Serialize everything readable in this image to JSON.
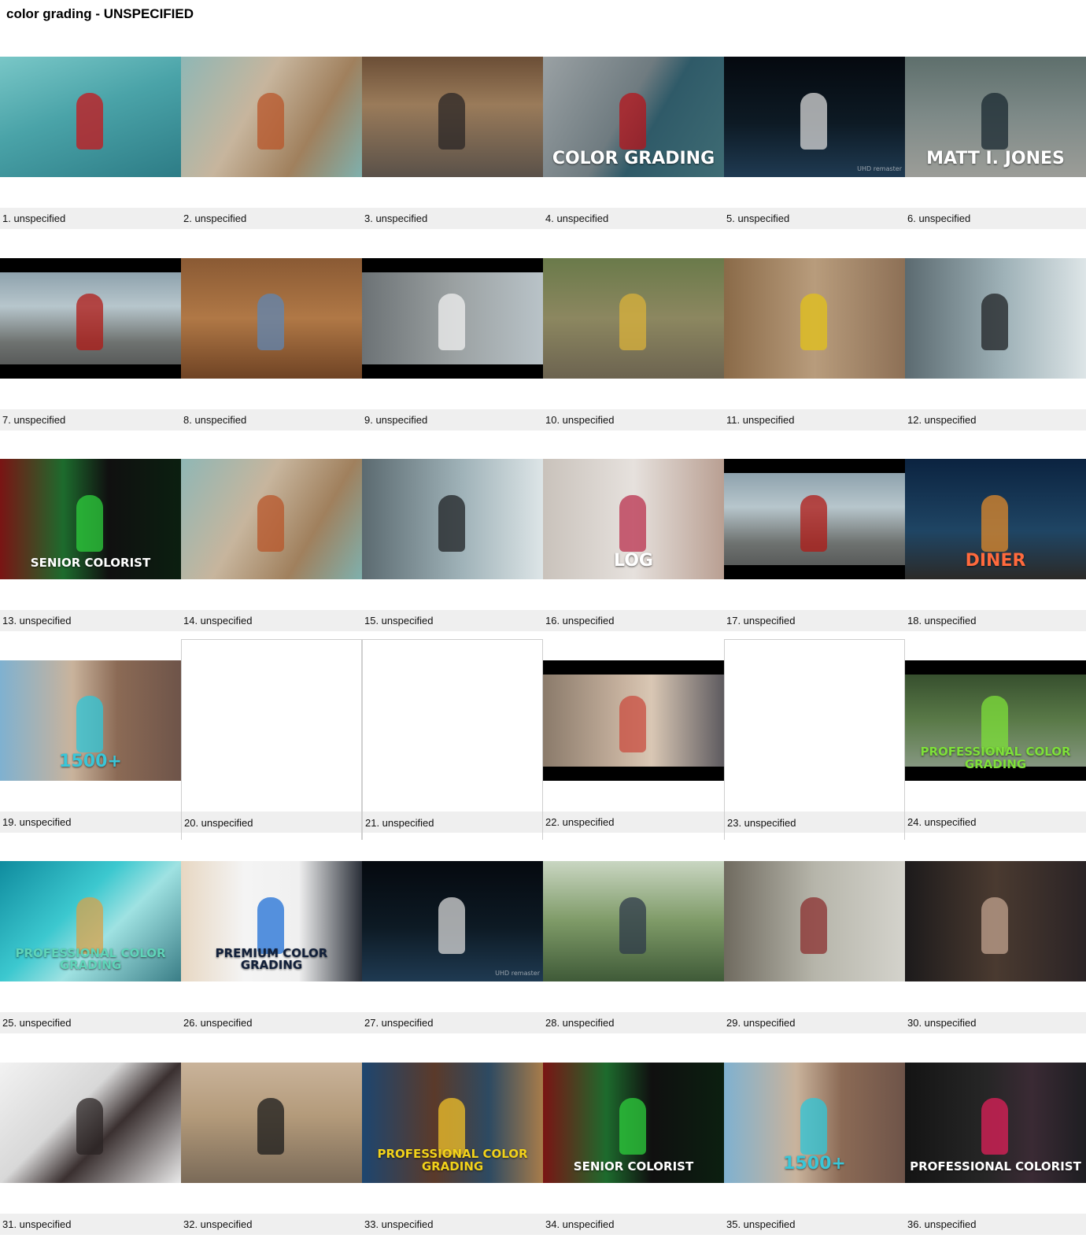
{
  "page": {
    "title": "color grading - UNSPECIFIED"
  },
  "grid": {
    "columns": 6,
    "items": [
      {
        "caption": "1. unspecified",
        "bg": "linear-gradient(160deg,#79c7c7 0%,#4aa3a8 45%,#2d7c86 100%)",
        "accent": "#c8161b",
        "overlay": ""
      },
      {
        "caption": "2. unspecified",
        "bg": "linear-gradient(120deg,#8fb7b5 0%,#c7b59d 40%,#a0805d 70%,#7fb0ad 100%)",
        "accent": "#b8562a",
        "overlay": ""
      },
      {
        "caption": "3. unspecified",
        "bg": "linear-gradient(180deg,#6b4e36 0%,#9a7b5a 40%,#5a5149 100%)",
        "accent": "#2a2626",
        "overlay": ""
      },
      {
        "caption": "4. unspecified",
        "bg": "linear-gradient(120deg,#9aa1a4 0%,#6f7b80 45%,#2f5a68 60%,#3f6c74 100%)",
        "accent": "#b5141b",
        "overlay": "COLOR GRADING",
        "overlayColor": "#ffffff"
      },
      {
        "caption": "5. unspecified",
        "bg": "linear-gradient(180deg,#05090f 0%,#0d1a24 55%,#1f3a52 100%)",
        "accent": "#d8d8d8",
        "overlay": "",
        "subtext": "UHD remaster"
      },
      {
        "caption": "6. unspecified",
        "bg": "linear-gradient(180deg,#5e6f6c 0%,#7e8a88 50%,#9c9d98 100%)",
        "accent": "#1a2830",
        "overlay": "MATT I. JONES",
        "overlayColor": "#ffffff"
      },
      {
        "caption": "7. unspecified",
        "bg": "linear-gradient(180deg,#7d93a0 0%,#b7c6cc 40%,#6e7270 70%,#4b4c4c 100%)",
        "accent": "#b01a16",
        "overlay": "",
        "letterbox": true
      },
      {
        "caption": "8. unspecified",
        "bg": "linear-gradient(180deg,#8a5a34 0%,#b07846 50%,#6f4324 100%)",
        "accent": "#5f86b3",
        "overlay": ""
      },
      {
        "caption": "9. unspecified",
        "bg": "linear-gradient(90deg,#6c7275 0%,#9aa0a1 50%,#b9c3c8 100%)",
        "accent": "#f0f0f0",
        "overlay": "",
        "letterbox": true
      },
      {
        "caption": "10. unspecified",
        "bg": "linear-gradient(180deg,#6a7a4a 0%,#8c8760 50%,#6c6350 100%)",
        "accent": "#d9b23b",
        "overlay": ""
      },
      {
        "caption": "11. unspecified",
        "bg": "linear-gradient(90deg,#8a6a48 0%,#b89c7c 50%,#8d7056 100%)",
        "accent": "#e3c21a",
        "overlay": ""
      },
      {
        "caption": "12. unspecified",
        "bg": "linear-gradient(90deg,#5b6a70 0%,#9fb2b8 55%,#dde5e7 100%)",
        "accent": "#1f2224",
        "overlay": ""
      },
      {
        "caption": "13. unspecified",
        "bg": "linear-gradient(90deg,#7a1414 0%,#1d6b2d 35%,#101010 60%,#0b1f10 100%)",
        "accent": "#2ecf3c",
        "overlay": "SENIOR COLORIST",
        "overlayColor": "#ffffff"
      },
      {
        "caption": "14. unspecified",
        "bg": "linear-gradient(120deg,#8fb7b5 0%,#c7b59d 40%,#a0805d 70%,#7fb0ad 100%)",
        "accent": "#b8562a",
        "overlay": ""
      },
      {
        "caption": "15. unspecified",
        "bg": "linear-gradient(90deg,#5b6a70 0%,#9fb2b8 55%,#dde5e7 100%)",
        "accent": "#1f2224",
        "overlay": ""
      },
      {
        "caption": "16. unspecified",
        "bg": "linear-gradient(90deg,#c9c2bb 0%,#e6e1dd 50%,#b99f92 100%)",
        "accent": "#b9304d",
        "overlay": "LOG",
        "overlayColor": "#ffffff"
      },
      {
        "caption": "17. unspecified",
        "bg": "linear-gradient(180deg,#7d93a0 0%,#b7c6cc 40%,#6e7270 70%,#4b4c4c 100%)",
        "accent": "#b01a16",
        "overlay": "",
        "letterbox": true
      },
      {
        "caption": "18. unspecified",
        "bg": "linear-gradient(180deg,#0b2340 0%,#1f4564 60%,#2b2a28 100%)",
        "accent": "#e08a2b",
        "overlay": "DINER",
        "overlayColor": "#ff6a3d"
      },
      {
        "caption": "19. unspecified",
        "bg": "linear-gradient(90deg,#7fb1d0 0%,#c9b39c 40%,#8b6a55 65%,#6e5449 100%)",
        "accent": "#2ec7d9",
        "overlay": "1500+",
        "overlayColor": "#39c6d8"
      },
      {
        "caption": "20. unspecified",
        "blank": true
      },
      {
        "caption": "21. unspecified",
        "blank": true
      },
      {
        "caption": "22. unspecified",
        "bg": "linear-gradient(90deg,#8a7a6a 0%,#c8b3a0 45%,#d9c7b4 60%,#5d5a5f 100%)",
        "accent": "#c94c3f",
        "overlay": "",
        "letterbox": true
      },
      {
        "caption": "23. unspecified",
        "blank": true
      },
      {
        "caption": "24. unspecified",
        "bg": "linear-gradient(180deg,#2c4226 0%,#5a7a48 50%,#93a092 100%)",
        "accent": "#7ee03a",
        "overlay": "PROFESSIONAL COLOR GRADING",
        "overlayColor": "#7ee03a",
        "letterbox": true
      },
      {
        "caption": "25. unspecified",
        "bg": "linear-gradient(135deg,#0f8b9e 0%,#3cc8cf 40%,#9fe2e2 60%,#3a7d86 100%)",
        "accent": "#d7a24a",
        "overlay": "PROFESSIONAL COLOR GRADING",
        "overlayColor": "#5fd4b8"
      },
      {
        "caption": "26. unspecified",
        "bg": "linear-gradient(90deg,#e7d7c2 0%,#f4f4f4 35%,#f0f0f0 65%,#2a2f38 100%)",
        "accent": "#1f6fd6",
        "overlay": "PREMIUM COLOR GRADING",
        "overlayColor": "#12203a"
      },
      {
        "caption": "27. unspecified",
        "bg": "linear-gradient(180deg,#05090f 0%,#0d1a24 55%,#1f3a52 100%)",
        "accent": "#d8d8d8",
        "overlay": "",
        "subtext": "UHD remaster"
      },
      {
        "caption": "28. unspecified",
        "bg": "linear-gradient(180deg,#c9d6c2 0%,#7e9a67 50%,#3f5a38 100%)",
        "accent": "#2e3a4a",
        "overlay": ""
      },
      {
        "caption": "29. unspecified",
        "bg": "linear-gradient(90deg,#6f6a5f 0%,#b6b5aa 50%,#d4d3cc 100%)",
        "accent": "#8b2f2f",
        "overlay": ""
      },
      {
        "caption": "30. unspecified",
        "bg": "linear-gradient(90deg,#1c1a1b 0%,#4a3a30 50%,#2a2325 100%)",
        "accent": "#c2a38f",
        "overlay": ""
      },
      {
        "caption": "31. unspecified",
        "bg": "linear-gradient(135deg,#f2f2f2 0%,#d8d8d8 40%,#3a3030 60%,#e9e9e9 100%)",
        "accent": "#2b2424",
        "overlay": ""
      },
      {
        "caption": "32. unspecified",
        "bg": "linear-gradient(180deg,#c9b39a 0%,#b39a7a 45%,#7a6a58 100%)",
        "accent": "#1b1b1b",
        "overlay": ""
      },
      {
        "caption": "33. unspecified",
        "bg": "linear-gradient(90deg,#1d4670 0%,#5b3a2a 40%,#2d4a62 70%,#a87c4a 100%)",
        "accent": "#f2c12a",
        "overlay": "PROFESSIONAL COLOR GRADING",
        "overlayColor": "#f2d21a"
      },
      {
        "caption": "34. unspecified",
        "bg": "linear-gradient(90deg,#7a1414 0%,#1d6b2d 35%,#101010 60%,#0b1f10 100%)",
        "accent": "#2ecf3c",
        "overlay": "SENIOR COLORIST",
        "overlayColor": "#ffffff"
      },
      {
        "caption": "35. unspecified",
        "bg": "linear-gradient(90deg,#7fb1d0 0%,#c9b39c 40%,#8b6a55 65%,#6e5449 100%)",
        "accent": "#2ec7d9",
        "overlay": "1500+",
        "overlayColor": "#39c6d8"
      },
      {
        "caption": "36. unspecified",
        "bg": "linear-gradient(90deg,#141414 0%,#262626 45%,#3a2a34 70%,#1e1e22 100%)",
        "accent": "#e0205a",
        "overlay": "PROFESSIONAL COLORIST",
        "overlayColor": "#ffffff"
      }
    ]
  }
}
